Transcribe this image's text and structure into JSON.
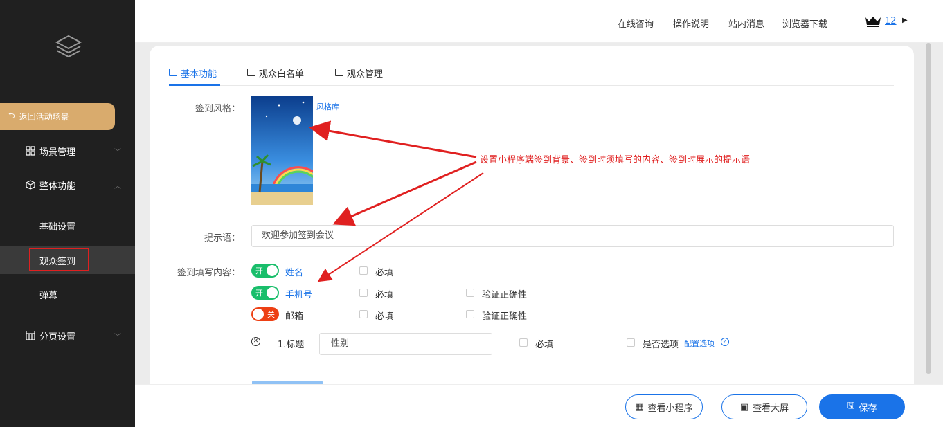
{
  "sidebar": {
    "back_label": "返回活动场景",
    "items": [
      {
        "label": "场景管理",
        "icon": "grid-icon"
      },
      {
        "label": "整体功能",
        "icon": "cube-icon"
      }
    ],
    "subitems": [
      {
        "label": "基础设置"
      },
      {
        "label": "观众签到"
      },
      {
        "label": "弹幕"
      }
    ],
    "page_settings": {
      "label": "分页设置",
      "icon": "layout-icon"
    }
  },
  "topbar": {
    "links": [
      "在线咨询",
      "操作说明",
      "站内消息",
      "浏览器下载"
    ],
    "vip_level": "12"
  },
  "tabs": [
    "基本功能",
    "观众白名单",
    "观众管理"
  ],
  "form": {
    "style_label": "签到风格：",
    "style_link": "风格库",
    "hint_label": "提示语：",
    "hint_value": "欢迎参加签到会议",
    "fill_label": "签到填写内容：",
    "fields": [
      {
        "toggle": "开",
        "state": "on",
        "name": "姓名",
        "required_label": "必填",
        "verify_label": ""
      },
      {
        "toggle": "开",
        "state": "on",
        "name": "手机号",
        "required_label": "必填",
        "verify_label": "验证正确性"
      },
      {
        "toggle": "关",
        "state": "off",
        "name": "邮箱",
        "required_label": "必填",
        "verify_label": "验证正确性"
      }
    ],
    "custom": {
      "title_label": "1.标题",
      "input_value": "性别",
      "required_label": "必填",
      "option_label": "是否选项",
      "config_link": "配置选项"
    }
  },
  "annotation": "设置小程序端签到背景、签到时须填写的内容、签到时展示的提示语",
  "bottom_buttons": {
    "miniprogram": "查看小程序",
    "bigscreen": "查看大屏",
    "save": "保存"
  },
  "colors": {
    "accent": "#1a73e8",
    "gold": "#d9ab6d",
    "sidebar": "#202020",
    "on": "#19be6b",
    "off": "#ed4014"
  }
}
